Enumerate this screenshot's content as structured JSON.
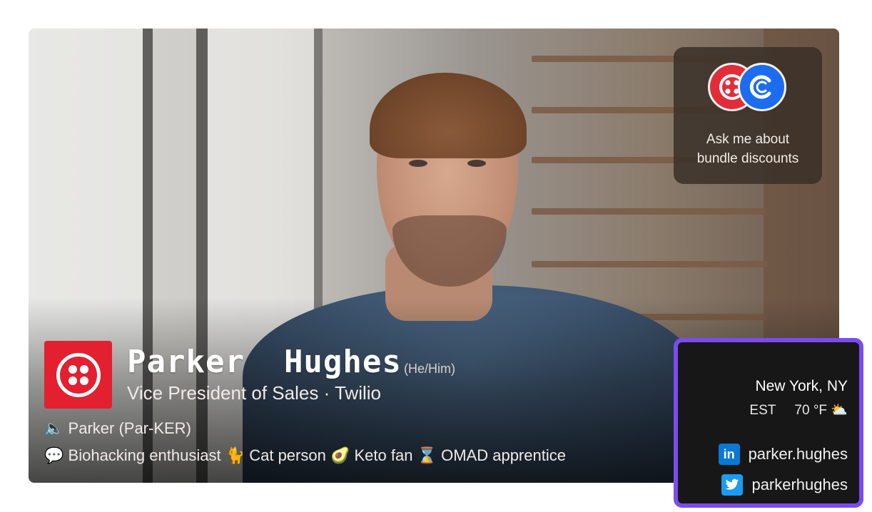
{
  "promo": {
    "line1": "Ask me about",
    "line2": "bundle discounts"
  },
  "profile": {
    "first_name": "Parker",
    "last_name": "Hughes",
    "pronouns": "(He/Him)",
    "role": "Vice President of Sales · Twilio",
    "pronunciation": "Parker (Par-KER)",
    "fun_facts": [
      {
        "icon": "speech-bubble-icon",
        "glyph": "💬",
        "label": "Biohacking enthusiast"
      },
      {
        "icon": "cat-icon",
        "glyph": "🐈",
        "label": "Cat person"
      },
      {
        "icon": "avocado-icon",
        "glyph": "🥑",
        "label": "Keto fan"
      },
      {
        "icon": "hourglass-icon",
        "glyph": "⌛",
        "label": "OMAD apprentice"
      }
    ]
  },
  "info": {
    "city": "New York, NY",
    "timezone": "EST",
    "temperature": "70 °F",
    "weather_icon": "partly-sunny-icon",
    "linkedin": "parker.hughes",
    "twitter": "parkerhughes"
  },
  "colors": {
    "twilio_red": "#e2202f",
    "accent_purple": "#7b4bf0",
    "calendly_blue": "#1b6cf0"
  }
}
